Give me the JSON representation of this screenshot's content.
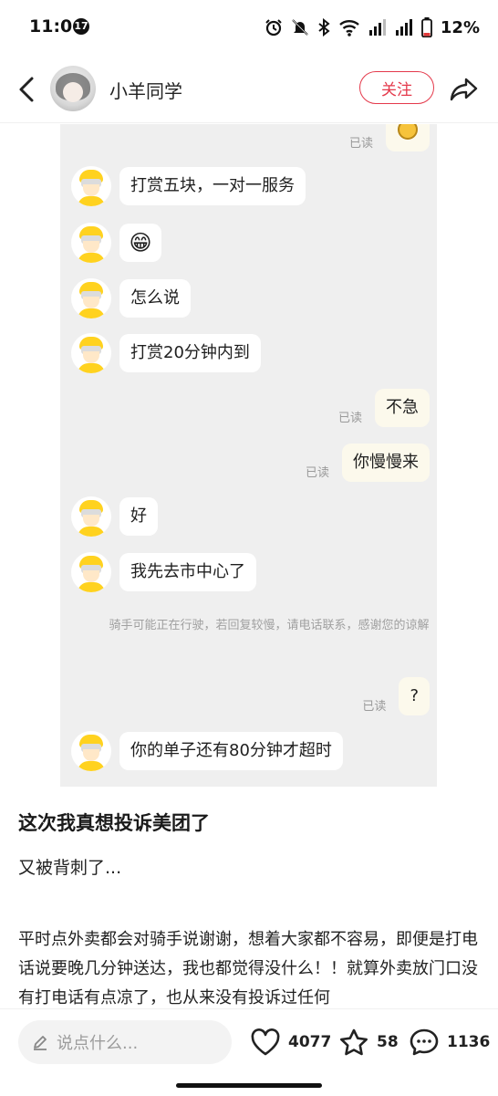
{
  "status_bar": {
    "time": "11:06",
    "notification_count": "17",
    "battery": "12%",
    "icons": [
      "alarm-icon",
      "mute-icon",
      "bluetooth-icon",
      "wifi-icon",
      "signal-icon",
      "signal-icon",
      "battery-icon"
    ]
  },
  "header": {
    "username": "小羊同学",
    "follow_label": "关注"
  },
  "chat": {
    "read_label": "已读",
    "messages": [
      {
        "side": "right",
        "type": "emoji",
        "read": true
      },
      {
        "side": "left",
        "text": "打赏五块，一对一服务"
      },
      {
        "side": "left",
        "type": "emoji",
        "emoji": "😁"
      },
      {
        "side": "left",
        "text": "怎么说"
      },
      {
        "side": "left",
        "text": "打赏20分钟内到"
      },
      {
        "side": "right",
        "text": "不急",
        "read": true
      },
      {
        "side": "right",
        "text": "你慢慢来",
        "read": true
      },
      {
        "side": "left",
        "text": "好"
      },
      {
        "side": "left",
        "text": "我先去市中心了"
      },
      {
        "side": "right",
        "text": "?",
        "read": true
      },
      {
        "side": "left",
        "text": "你的单子还有80分钟才超时"
      }
    ],
    "system_note": "骑手可能正在行驶，若回复较慢，请电话联系，感谢您的谅解"
  },
  "post": {
    "title": "这次我真想投诉美团了",
    "subtitle": "又被背刺了...",
    "body": "平时点外卖都会对骑手说谢谢，想着大家都不容易，即便是打电话说要晚几分钟送达，我也都觉得没什么！！就算外卖放门口没有打电话有点凉了，也从来没有投诉过任何"
  },
  "bottom_bar": {
    "comment_placeholder": "说点什么...",
    "likes": "4077",
    "favorites": "58",
    "comments": "1136"
  },
  "colors": {
    "accent_red": "#e4394b",
    "chat_bg": "#efefef",
    "rider_yellow": "#ffd21f"
  }
}
